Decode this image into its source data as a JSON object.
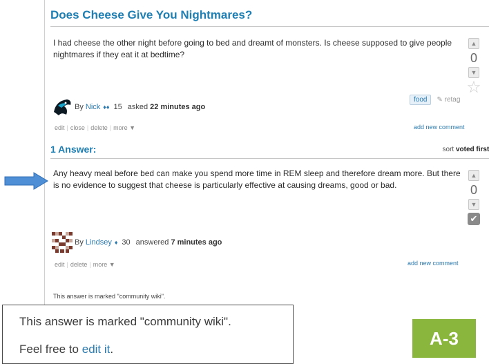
{
  "question": {
    "title": "Does Cheese Give You Nightmares?",
    "body": "I had cheese the other night before going to bed and dreamt of monsters. Is cheese supposed to give people nightmares if they eat it at bedtime?",
    "votes": "0",
    "author": {
      "by": "By",
      "name": "Nick",
      "badge": "♦♦",
      "rep": "15",
      "action": "asked",
      "time": "22 minutes ago"
    },
    "tag": "food",
    "retag": "retag",
    "links": {
      "edit": "edit",
      "close": "close",
      "delete": "delete",
      "more": "more ▼"
    },
    "add_comment": "add new comment"
  },
  "answers_header": {
    "count": "1 Answer:",
    "sort_label": "sort",
    "sort_value": "voted first ▼"
  },
  "answer": {
    "body": "Any heavy meal before bed can make you spend more time in REM sleep and therefore dream more. But there is no evidence to suggest that cheese is particularly effective at causing dreams, good or bad.",
    "votes": "0",
    "author": {
      "by": "By",
      "name": "Lindsey",
      "badge": "♦",
      "rep": "30",
      "action": "answered",
      "time": "7 minutes ago"
    },
    "links": {
      "edit": "edit",
      "delete": "delete",
      "more": "more ▼"
    },
    "add_comment": "add new comment",
    "wiki_note": "This answer is marked \"community wiki\"."
  },
  "zoom": {
    "line1": "This answer is marked \"community wiki\".",
    "line2_prefix": "Feel free to",
    "edit_link": "edit it",
    "line2_suffix": "."
  },
  "badge": "A-3",
  "colors": {
    "title_blue": "#1f7fb3",
    "link_blue": "#2a7ab0",
    "badge_green": "#8ab63e",
    "arrow_blue": "#4f8fd6"
  },
  "icons": {
    "upvote": "▲",
    "downvote": "▼",
    "favorite": "☆",
    "accepted": "✔",
    "retag": "✎"
  }
}
